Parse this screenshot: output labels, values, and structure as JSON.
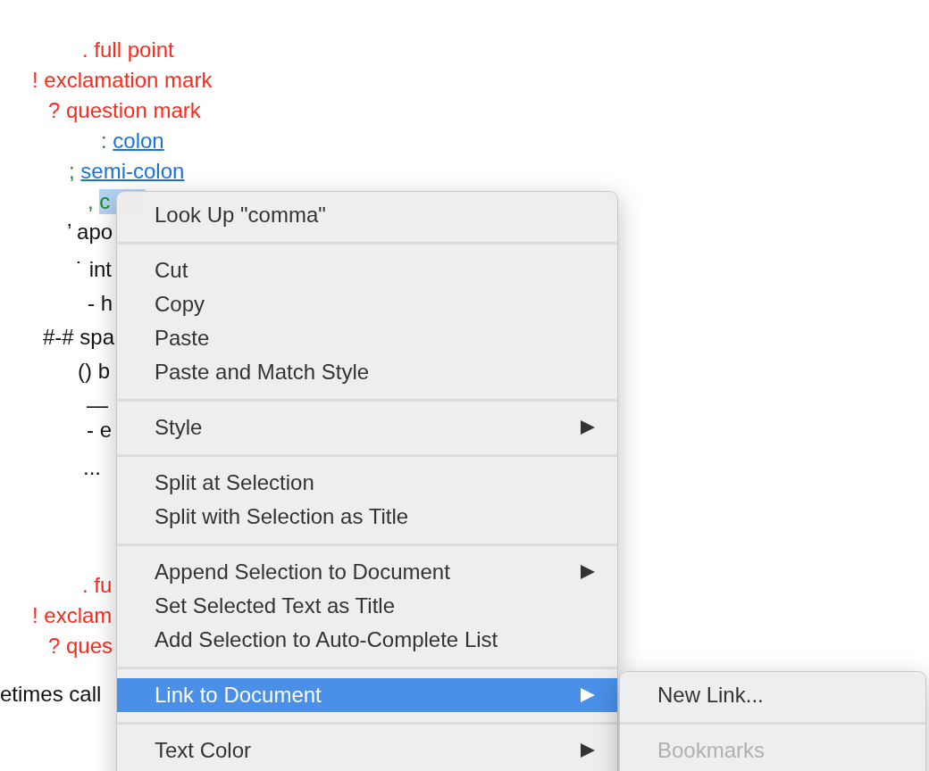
{
  "document": {
    "lines": [
      {
        "segments": [
          {
            "text": ". full point",
            "kind": "red",
            "selected": false
          }
        ]
      },
      {
        "segments": [
          {
            "text": "! exclamation mark",
            "kind": "red",
            "selected": false
          }
        ]
      },
      {
        "segments": [
          {
            "text": "? question mark",
            "kind": "red",
            "selected": false
          }
        ]
      },
      {
        "segments": [
          {
            "text": ": ",
            "kind": "green",
            "selected": false
          },
          {
            "text": "colon",
            "kind": "link",
            "selected": false
          }
        ]
      },
      {
        "segments": [
          {
            "text": "; ",
            "kind": "green",
            "selected": false
          },
          {
            "text": "semi-colon",
            "kind": "link",
            "selected": false
          }
        ]
      },
      {
        "segments": [
          {
            "text": ", ",
            "kind": "green",
            "selected": false
          },
          {
            "text": "c",
            "kind": "green",
            "selected": true
          }
        ]
      },
      {
        "segments": [
          {
            "text": "’ apo",
            "kind": "plain",
            "selected": false
          }
        ]
      },
      {
        "segments": [
          {
            "text": "˙ int",
            "kind": "plain",
            "selected": false
          }
        ]
      },
      {
        "segments": [
          {
            "text": "- h",
            "kind": "plain",
            "selected": false
          }
        ]
      },
      {
        "segments": [
          {
            "text": "#-# spa",
            "kind": "plain",
            "selected": false
          }
        ]
      },
      {
        "segments": [
          {
            "text": "() b",
            "kind": "plain",
            "selected": false
          }
        ]
      },
      {
        "segments": [
          {
            "text": "—",
            "kind": "plain",
            "selected": false
          }
        ]
      },
      {
        "segments": [
          {
            "text": "- e",
            "kind": "plain",
            "selected": false
          }
        ]
      },
      {
        "segments": [
          {
            "text": "...",
            "kind": "plain",
            "selected": false
          }
        ]
      },
      {
        "segments": [
          {
            "text": ". fu",
            "kind": "red",
            "selected": false
          }
        ]
      },
      {
        "segments": [
          {
            "text": "! exclam",
            "kind": "red",
            "selected": false
          }
        ]
      },
      {
        "segments": [
          {
            "text": "? ques",
            "kind": "red",
            "selected": false
          }
        ]
      },
      {
        "segments": [
          {
            "text": "etimes call",
            "kind": "plain",
            "selected": false
          }
        ]
      }
    ]
  },
  "context_menu": {
    "items": [
      {
        "kind": "item",
        "label": "Look Up \"comma\"",
        "submenu": false,
        "highlighted": false
      },
      {
        "kind": "separator"
      },
      {
        "kind": "item",
        "label": "Cut",
        "submenu": false,
        "highlighted": false
      },
      {
        "kind": "item",
        "label": "Copy",
        "submenu": false,
        "highlighted": false
      },
      {
        "kind": "item",
        "label": "Paste",
        "submenu": false,
        "highlighted": false
      },
      {
        "kind": "item",
        "label": "Paste and Match Style",
        "submenu": false,
        "highlighted": false
      },
      {
        "kind": "separator"
      },
      {
        "kind": "item",
        "label": "Style",
        "submenu": true,
        "highlighted": false
      },
      {
        "kind": "separator"
      },
      {
        "kind": "item",
        "label": "Split at Selection",
        "submenu": false,
        "highlighted": false
      },
      {
        "kind": "item",
        "label": "Split with Selection as Title",
        "submenu": false,
        "highlighted": false
      },
      {
        "kind": "separator"
      },
      {
        "kind": "item",
        "label": "Append Selection to Document",
        "submenu": true,
        "highlighted": false
      },
      {
        "kind": "item",
        "label": "Set Selected Text as Title",
        "submenu": false,
        "highlighted": false
      },
      {
        "kind": "item",
        "label": "Add Selection to Auto-Complete List",
        "submenu": false,
        "highlighted": false
      },
      {
        "kind": "separator"
      },
      {
        "kind": "item",
        "label": "Link to Document",
        "submenu": true,
        "highlighted": true
      },
      {
        "kind": "separator"
      },
      {
        "kind": "item",
        "label": "Text Color",
        "submenu": true,
        "highlighted": false
      }
    ]
  },
  "submenu": {
    "items": [
      {
        "kind": "item",
        "label": "New Link...",
        "disabled": false
      },
      {
        "kind": "separator"
      },
      {
        "kind": "item",
        "label": "Bookmarks",
        "disabled": true
      }
    ]
  }
}
